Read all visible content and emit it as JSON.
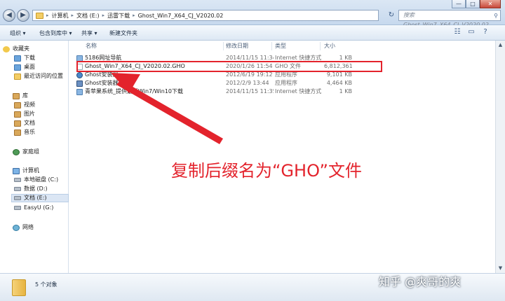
{
  "window": {
    "controls": {
      "minimize": "—",
      "maximize": "□",
      "close": "✕"
    }
  },
  "addressbar": {
    "crumbs": [
      "计算机",
      "文档 (E:)",
      "迅雷下载",
      "Ghost_Win7_X64_CJ_V2020.02"
    ],
    "search_placeholder": "搜索 Ghost_Win7_X64_CJ_V2020.02"
  },
  "toolbar": {
    "organize": "组织 ▾",
    "include_in_library": "包含到库中 ▾",
    "share": "共享 ▾",
    "new_folder": "新建文件夹"
  },
  "navpane": {
    "favorites": "收藏夹",
    "fav_items": [
      "下载",
      "桌面",
      "最近访问的位置"
    ],
    "libraries": "库",
    "lib_items": [
      "视频",
      "图片",
      "文档",
      "音乐"
    ],
    "homegroup": "家庭组",
    "computer": "计算机",
    "drives": [
      "本地磁盘 (C:)",
      "数据 (D:)",
      "文档 (E:)",
      "EasyU (G:)"
    ],
    "network": "网络"
  },
  "columns": {
    "name": "名称",
    "modified": "修改日期",
    "type": "类型",
    "size": "大小"
  },
  "files": [
    {
      "name": "5186网址导航",
      "modified": "2014/11/15 11:34",
      "type": "Internet 快捷方式",
      "size": "1 KB",
      "icon": "url-icon"
    },
    {
      "name": "Ghost_Win7_X64_CJ_V2020.02.GHO",
      "modified": "2020/1/26 11:54",
      "type": "GHO 文件",
      "size": "6,812,361...",
      "icon": "gho-file-icon"
    },
    {
      "name": "Ghost安装器",
      "modified": "2012/6/19 19:12",
      "type": "应用程序",
      "size": "9,101 KB",
      "icon": "ghost-app-icon"
    },
    {
      "name": "Ghost安装器-2",
      "modified": "2012/2/9 13:44",
      "type": "应用程序",
      "size": "4,464 KB",
      "icon": "ghost-app-icon"
    },
    {
      "name": "青苹果系统_提供最新Win7/Win10下载",
      "modified": "2014/11/15 11:35",
      "type": "Internet 快捷方式",
      "size": "1 KB",
      "icon": "url-icon"
    }
  ],
  "details": {
    "count": "5 个对象"
  },
  "annotation": {
    "callout": "复制后缀名为“GHO”文件",
    "color": "#e3232c"
  },
  "watermark": "知乎 @爽哥的爽"
}
